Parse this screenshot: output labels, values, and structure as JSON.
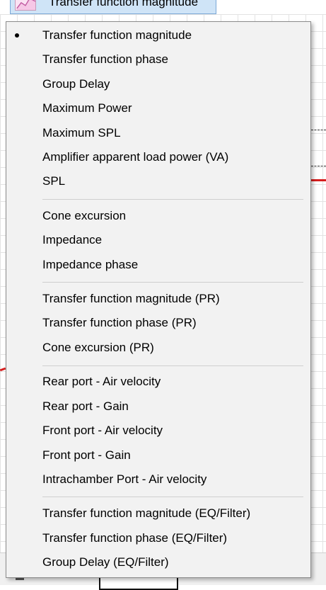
{
  "top_button": {
    "label": "Transfer function magnitude",
    "icon": "graph-icon"
  },
  "menu": {
    "checked_index": 0,
    "items": [
      "Transfer function magnitude",
      "Transfer function phase",
      "Group Delay",
      "Maximum Power",
      "Maximum SPL",
      "Amplifier apparent load power (VA)",
      "SPL",
      "Cone excursion",
      "Impedance",
      "Impedance phase",
      "Transfer function magnitude (PR)",
      "Transfer function phase (PR)",
      "Cone excursion (PR)",
      "Rear port - Air velocity",
      "Rear port - Gain",
      "Front port - Air velocity",
      "Front port - Gain",
      "Intrachamber Port - Air velocity",
      "Transfer function magnitude (EQ/Filter)",
      "Transfer function phase (EQ/Filter)",
      "Group Delay (EQ/Filter)"
    ]
  },
  "colors": {
    "menu_bg": "#f2f2f2",
    "button_bg": "#cfe4f7",
    "graph_line": "#d61e1e"
  }
}
